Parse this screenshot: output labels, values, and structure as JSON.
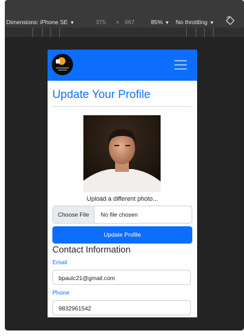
{
  "devtools": {
    "dimensions_label": "Dimensions: iPhone SE",
    "width": "375",
    "times": "×",
    "height": "667",
    "zoom": "85%",
    "throttling": "No throttling",
    "caret": "▼"
  },
  "site": {
    "logo_icon": "brand-logo",
    "menu_icon": "hamburger-menu-icon"
  },
  "profile": {
    "title": "Update Your Profile",
    "upload_label": "Upload a different photo...",
    "choose_file": "Choose File",
    "no_file": "No file chosen",
    "submit": "Update Profile"
  },
  "contact": {
    "title": "Contact Information",
    "email_label": "Email",
    "email_value": "bpaulc21@gmail.com",
    "phone_label": "Phone",
    "phone_value": "9832961542"
  },
  "colors": {
    "primary": "#0d6efd",
    "devtools_bg": "#242424"
  }
}
